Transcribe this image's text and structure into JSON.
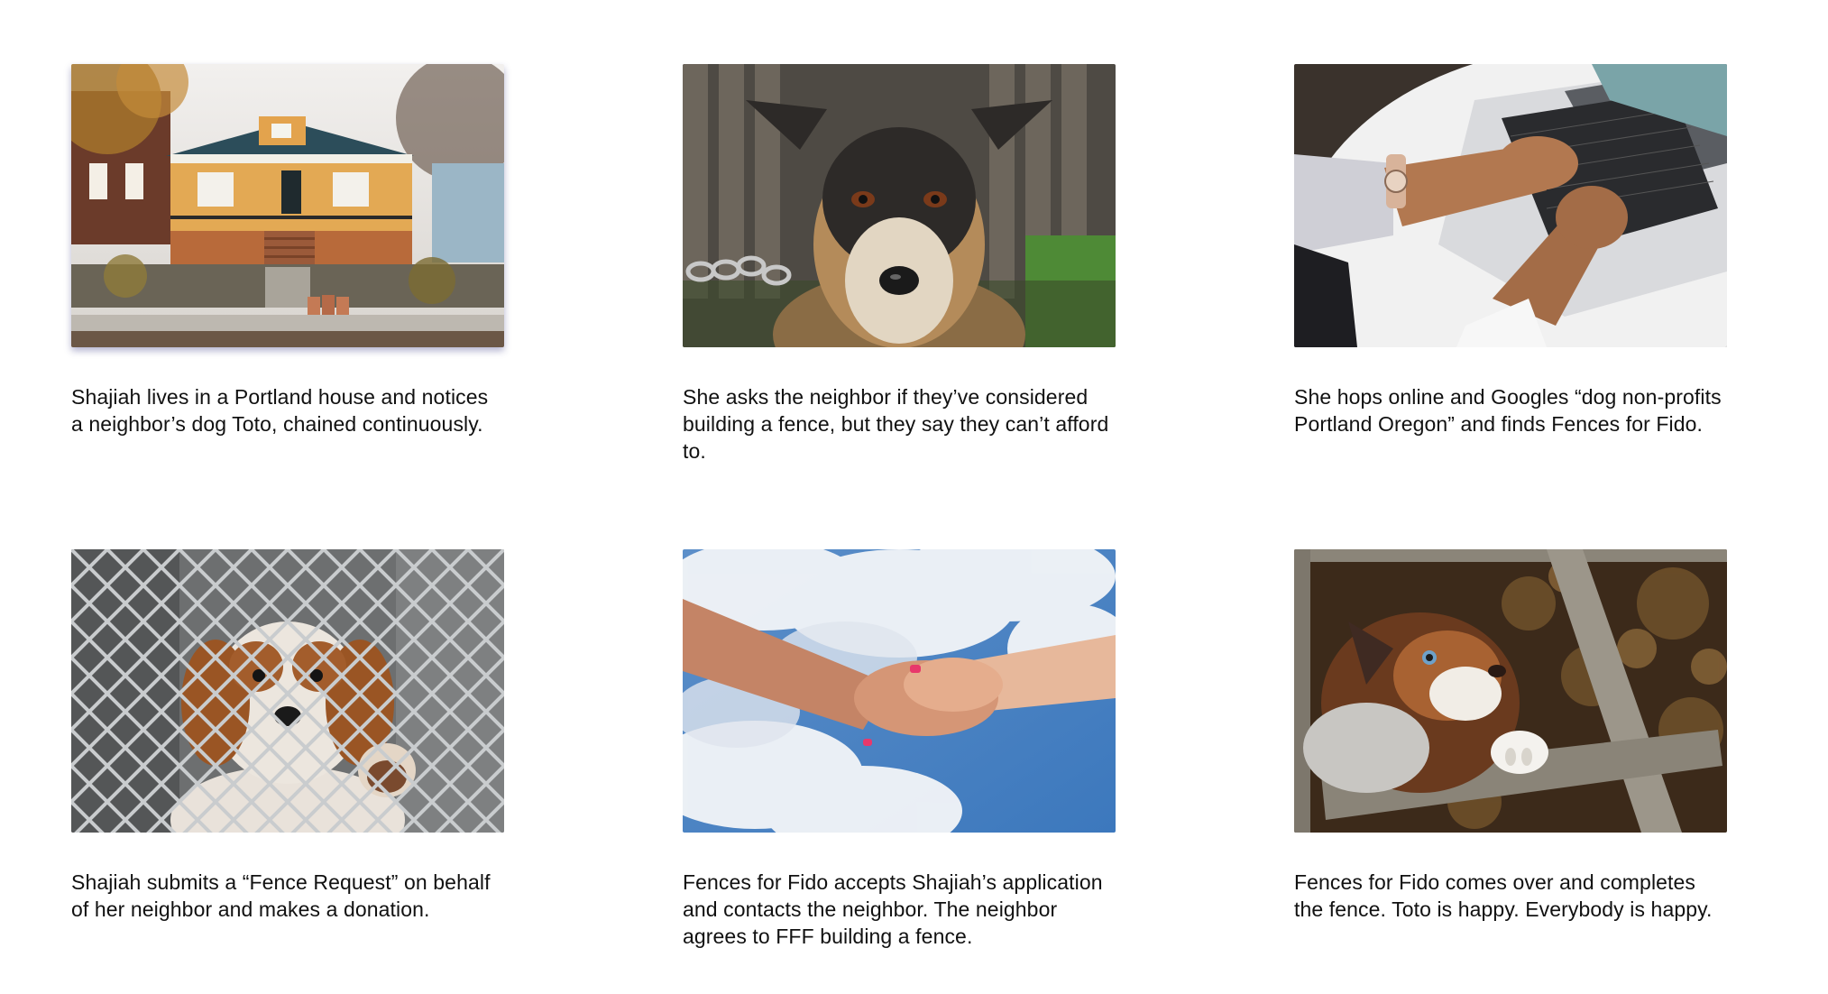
{
  "panels": [
    {
      "image": "portland-house-photo",
      "caption": "Shajiah lives in a Portland house and notices a neighbor’s dog Toto, chained continuously."
    },
    {
      "image": "chained-dog-photo",
      "caption": "She asks the neighbor if they’ve considered building a fence, but they say they can’t afford to."
    },
    {
      "image": "laptop-typing-photo",
      "caption": "She hops online and Googles “dog non-profits Portland Oregon” and finds Fences for Fido."
    },
    {
      "image": "puppy-behind-fence-photo",
      "caption": "Shajiah submits a “Fence Request” on behalf of her neighbor and makes a donation."
    },
    {
      "image": "handshake-photo",
      "caption": "Fences for Fido accepts Shajiah’s application and contacts the neighbor. The neighbor agrees to FFF building a fence."
    },
    {
      "image": "happy-dog-fence-photo",
      "caption": "Fences for Fido comes over and completes the fence. Toto is happy. Everybody is happy."
    }
  ]
}
